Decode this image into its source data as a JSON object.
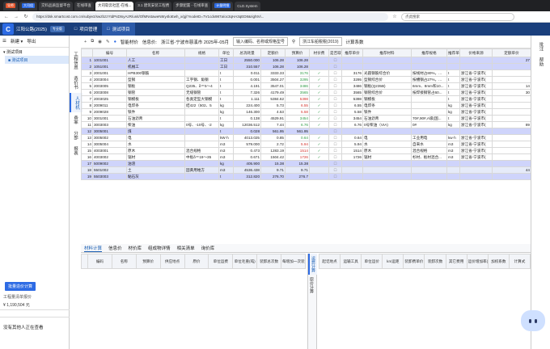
{
  "browser": {
    "tabs": [
      {
        "badge": "导师",
        "badge_color": "#e4572e",
        "label": ""
      },
      {
        "badge": "大司组",
        "badge_color": "#2d6be4",
        "label": ""
      },
      {
        "badge": "",
        "badge_color": "",
        "label": "交料品质监督平台"
      },
      {
        "badge": "",
        "badge_color": "",
        "label": "在线审查"
      },
      {
        "badge": "",
        "badge_color": "",
        "label": "大司软云社区-在线..."
      },
      {
        "badge": "",
        "badge_color": "",
        "label": "3.1 建筑安装工程费"
      },
      {
        "badge": "",
        "badge_color": "",
        "label": "步骤配置 - 在线审查"
      },
      {
        "badge": "计量明细",
        "badge_color": "#2d6be4",
        "label": ""
      },
      {
        "badge": "",
        "badge_color": "",
        "label": "CLD.System"
      }
    ],
    "url": "https://dsk.smartcost.com.cn/subject/swzbzzYtdPsDtsyAzR/unit/OfMNstaweN8ry4loEwh_x/gj/?nodeID=7V1cdx987a/oc3qHA3qED8&rightVi...",
    "search_placeholder": "点此搜索"
  },
  "app": {
    "logo": "C",
    "project": "江阳公路(2025)",
    "mode": "专业版",
    "tabs": [
      "项目管理",
      "测试项目"
    ]
  },
  "left": {
    "new_label": "新建",
    "export_label": "导出",
    "tree": [
      "测试项目",
      "测试项目"
    ],
    "batch_button": "批量造价计算",
    "qty_label": "工程量清单报价",
    "total": "¥ 1,190,504 元",
    "online_msg": "没有其他人正在查看"
  },
  "vtabs": [
    "工程信息",
    "造价书",
    "人材机",
    "费率",
    "分部",
    "报表"
  ],
  "toolbar": {
    "smart_price": "智能材价",
    "info_price": "信息价:",
    "region": "浙江省-宁波市慈溪市 2025年-05月",
    "search_placeholder": "输入编码、名称或规格型号",
    "std": "浙江车船税税(2019)",
    "calc": "计算系数"
  },
  "grid": {
    "headers": [
      "编号",
      "名称",
      "规格",
      "单位",
      "总消耗量",
      "定额价",
      "预算价",
      "材价费",
      "是否取价",
      "推荐单价",
      "推荐材料",
      "推荐规格",
      "推荐单位",
      "价格来源",
      "定额单价"
    ],
    "rows": [
      {
        "n": "1",
        "code": "1001001",
        "name": "人工",
        "spec": "",
        "unit": "工日",
        "qty": "2550.000",
        "base": "106.28",
        "budget": "106.28",
        "bc": "",
        "chk": "",
        "r_price": "",
        "r_name": "",
        "r_spec": "",
        "r_unit": "",
        "src": "",
        "dp": "27",
        "style": "lav"
      },
      {
        "n": "2",
        "code": "1051001",
        "name": "机械工",
        "spec": "",
        "unit": "工日",
        "qty": "310.557",
        "base": "106.28",
        "budget": "106.28",
        "bc": "",
        "chk": "",
        "r_price": "",
        "r_name": "",
        "r_spec": "",
        "r_unit": "",
        "src": "",
        "dp": "",
        "style": "lav"
      },
      {
        "n": "3",
        "code": "2001001",
        "name": "HPB300钢筋",
        "spec": "",
        "unit": "t",
        "qty": "0.011",
        "base": "3333.33",
        "budget": "3176",
        "bc": "g",
        "chk": "✓",
        "r_price": "3176",
        "r_name": "光圆钢筋综合价",
        "r_spec": "按线材占80%，...",
        "r_unit": "t",
        "src": "浙江省-宁波市(",
        "dp": "",
        "style": ""
      },
      {
        "n": "4",
        "code": "2003004",
        "name": "型钢",
        "spec": "工字钢、角钢",
        "unit": "t",
        "qty": "0.001",
        "base": "3504.27",
        "budget": "3295",
        "bc": "g",
        "chk": "✓",
        "r_price": "3295",
        "r_name": "型钢综合价",
        "r_spec": "按槽钢占27%，...",
        "r_unit": "t",
        "src": "浙江省-宁波市(",
        "dp": "",
        "style": ""
      },
      {
        "n": "5",
        "code": "2003005",
        "name": "钢板",
        "spec": "Q235、δ＝5～4",
        "unit": "t",
        "qty": "4.191",
        "base": "3547.01",
        "budget": "3486",
        "bc": "g",
        "chk": "✓",
        "r_price": "3486",
        "r_name": "钢板(Q235B)",
        "r_spec": "6mm、8mm和10...",
        "r_unit": "t",
        "src": "浙江省-宁波市(",
        "dp": "14",
        "style": ""
      },
      {
        "n": "6",
        "code": "2003008",
        "name": "钢管",
        "spec": "无缝钢管",
        "unit": "t",
        "qty": "7.326",
        "base": "4179.49",
        "budget": "3565",
        "bc": "g",
        "chk": "✓",
        "r_price": "3565",
        "r_name": "钢管综合价",
        "r_spec": "按焊接钢管占60...",
        "r_unit": "t",
        "src": "浙江省-宁波市(",
        "dp": "30",
        "style": ""
      },
      {
        "n": "7",
        "code": "2003025",
        "name": "钢模板",
        "spec": "各类定型大钢模",
        "unit": "t",
        "qty": "1.111",
        "base": "5384.62",
        "budget": "5398",
        "bc": "rd",
        "chk": "✓",
        "r_price": "5398",
        "r_name": "钢模板",
        "r_spec": "",
        "r_unit": "t",
        "src": "浙江省-宁波市(",
        "dp": "",
        "style": ""
      },
      {
        "n": "8",
        "code": "2009011",
        "name": "电焊条",
        "spec": "结422（502、5",
        "unit": "kg",
        "qty": "224.400",
        "base": "5.73",
        "budget": "6.55",
        "bc": "rd",
        "chk": "✓",
        "r_price": "6.55",
        "r_name": "电焊条",
        "r_spec": "",
        "r_unit": "kg",
        "src": "浙江省-宁波市(",
        "dp": "",
        "style": ""
      },
      {
        "n": "9",
        "code": "2009028",
        "name": "铁件",
        "spec": "",
        "unit": "kg",
        "qty": "146.300",
        "base": "4.53",
        "budget": "5.58",
        "bc": "rd",
        "chk": "✓",
        "r_price": "5.58",
        "r_name": "铁件",
        "r_spec": "",
        "r_unit": "kg",
        "src": "浙江省-宁波市(",
        "dp": "",
        "style": ""
      },
      {
        "n": "10",
        "code": "3001001",
        "name": "石油沥青",
        "spec": "",
        "unit": "t",
        "qty": "0.138",
        "base": "4529.91",
        "budget": "3454",
        "bc": "g",
        "chk": "✓",
        "r_price": "3454",
        "r_name": "石油沥青",
        "r_spec": "70#,90#,A级(国...",
        "r_unit": "t",
        "src": "浙江省-宁波市(",
        "dp": "",
        "style": ""
      },
      {
        "n": "11",
        "code": "3003003",
        "name": "柴油",
        "spec": "0号、-10号、-2",
        "unit": "kg",
        "qty": "12036.512",
        "base": "7.44",
        "budget": "6.76",
        "bc": "g",
        "chk": "✓",
        "r_price": "6.76",
        "r_name": "0号柴油（VIA)",
        "r_spec": "0#",
        "r_unit": "kg",
        "src": "浙江省-宁波市(",
        "dp": "89",
        "style": ""
      },
      {
        "n": "12",
        "code": "3005001",
        "name": "煤",
        "spec": "",
        "unit": "t",
        "qty": "0.028",
        "base": "561.95",
        "budget": "561.95",
        "bc": "",
        "chk": "",
        "r_price": "",
        "r_name": "",
        "r_spec": "",
        "r_unit": "",
        "src": "",
        "dp": "",
        "style": "lav"
      },
      {
        "n": "13",
        "code": "3005002",
        "name": "电",
        "spec": "",
        "unit": "kW·h",
        "qty": "4013.025",
        "base": "0.85",
        "budget": "0.64",
        "bc": "g",
        "chk": "✓",
        "r_price": "0.64",
        "r_name": "电",
        "r_spec": "工业用电",
        "r_unit": "kw·h",
        "src": "浙江省-宁波市(",
        "dp": "",
        "style": ""
      },
      {
        "n": "14",
        "code": "3005004",
        "name": "水",
        "spec": "",
        "unit": "m3",
        "qty": "579.000",
        "base": "2.72",
        "budget": "5.94",
        "bc": "rd",
        "chk": "✓",
        "r_price": "5.94",
        "r_name": "水",
        "r_spec": "自来水",
        "r_unit": "m3",
        "src": "浙江省-宁波市(",
        "dp": "",
        "style": ""
      },
      {
        "n": "15",
        "code": "4003001",
        "name": "原木",
        "spec": "混合规格",
        "unit": "m3",
        "qty": "0.473",
        "base": "1283.19",
        "budget": "1514",
        "bc": "rd",
        "chk": "✓",
        "r_price": "1514",
        "r_name": "原木",
        "r_spec": "混合规格",
        "r_unit": "m3",
        "src": "浙江省-宁波市(",
        "dp": "",
        "style": ""
      },
      {
        "n": "16",
        "code": "4003002",
        "name": "锯材",
        "spec": "中板δ＝19～35",
        "unit": "m3",
        "qty": "0.671",
        "base": "1504.42",
        "budget": "1726",
        "bc": "rd",
        "chk": "✓",
        "r_price": "1726",
        "r_name": "锯材",
        "r_spec": "杉材、板材混合...",
        "r_unit": "m3",
        "src": "浙江省-宁波市(",
        "dp": "",
        "style": ""
      },
      {
        "n": "17",
        "code": "5009002",
        "name": "油渣",
        "spec": "",
        "unit": "kg",
        "qty": "405.900",
        "base": "15.38",
        "budget": "15.38",
        "bc": "",
        "chk": "",
        "r_price": "",
        "r_name": "",
        "r_spec": "",
        "r_unit": "",
        "src": "",
        "dp": "",
        "style": "lav"
      },
      {
        "n": "18",
        "code": "5501002",
        "name": "土",
        "spec": "固黄用堆方",
        "unit": "m3",
        "qty": "4536.438",
        "base": "9.71",
        "budget": "9.71",
        "bc": "",
        "chk": "",
        "r_price": "",
        "r_name": "",
        "r_spec": "",
        "r_unit": "",
        "src": "",
        "dp": "44",
        "style": "sel"
      },
      {
        "n": "19",
        "code": "5503003",
        "name": "黏石灰",
        "spec": "",
        "unit": "t",
        "qty": "312.820",
        "base": "276.70",
        "budget": "276.7",
        "bc": "",
        "chk": "",
        "r_price": "",
        "r_name": "",
        "r_spec": "",
        "r_unit": "",
        "src": "",
        "dp": "",
        "style": "lav"
      }
    ]
  },
  "bottom": {
    "tabs": [
      "材料计算",
      "信息价",
      "材价库",
      "组成物详情",
      "相关清单",
      "询价库"
    ],
    "left_headers": [
      "编码",
      "名称",
      "预算价",
      "供应地点",
      "原价",
      "单位运费",
      "单位毛重(吨)",
      "装卸总次数",
      "每增加一次装卸损耗率"
    ],
    "mid_tabs": [
      "运费计算",
      "原价计算"
    ],
    "right_headers": [
      "起讫地点",
      "运输工具",
      "单位运价",
      "km运距",
      "装卸费单价",
      "装卸次数",
      "其它费用",
      "运价增加率(%)",
      "加权系数",
      "计算式"
    ]
  },
  "right": {
    "labels": [
      "批注",
      "帮助"
    ]
  }
}
